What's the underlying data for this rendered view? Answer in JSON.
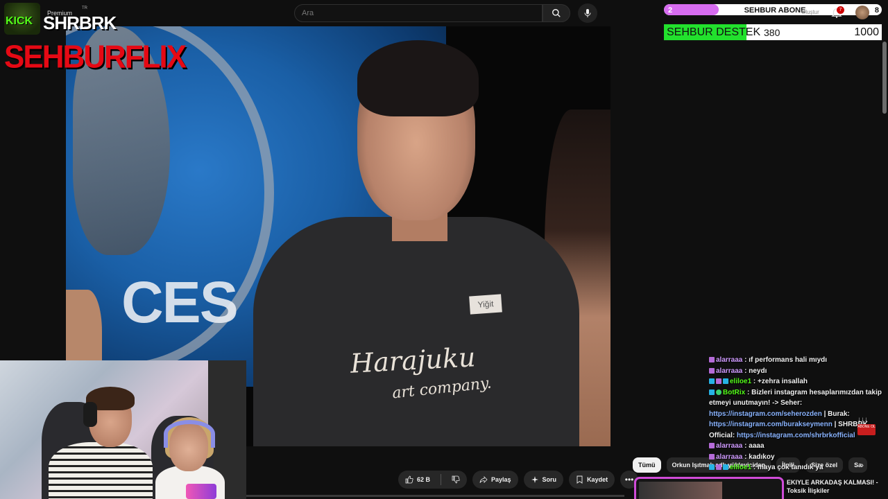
{
  "search": {
    "placeholder": "Ara"
  },
  "header": {
    "olustur_label": "Oluştur",
    "notification_count": "7"
  },
  "logo": {
    "kick": "KICK",
    "premium": "Premium",
    "tr": "TR",
    "channel": "SHRBRK",
    "brand": "SEHBURFLIX"
  },
  "overlay": {
    "sub_goal": {
      "current": "2",
      "title": "SEHBUR ABONE",
      "max": "8",
      "progress_fraction": 0.25,
      "color": "#d76cf0"
    },
    "donation": {
      "title": "SEHBUR DESTEK",
      "current": "380",
      "max": "1000",
      "progress_fraction": 0.38,
      "color": "#22e12d"
    }
  },
  "video": {
    "nametag": "Yiğit",
    "shirt_line1": "Harajuku",
    "shirt_line2": "art company.",
    "bg_text": "CES"
  },
  "actions": {
    "like_count": "62 B",
    "share": "Paylaş",
    "ask": "Soru",
    "save": "Kaydet",
    "icons": [
      "thumbs-up-icon",
      "thumbs-down-icon",
      "share-icon",
      "sparkle-icon",
      "bookmark-icon",
      "more-icon"
    ]
  },
  "chat": [
    {
      "user": "alarraaa",
      "text": ": ıf performans hali mıydı"
    },
    {
      "user": "alarraaa",
      "text": ": neydı"
    },
    {
      "user": "eliloe1",
      "text": ": +zehra insallah"
    },
    {
      "user": "BotRix",
      "text": ": Bizleri instagram hesaplarımızdan takip etmeyi unutmayın! -> Seher:",
      "link1": "https://instagram.com/seherozden",
      "mid1": " | Burak:",
      "link2": "https://instagram.com/burakseymenn",
      "mid2": " | SHRBRK Official:",
      "link3": "https://instagram.com/shrbrkofficial"
    },
    {
      "user": "alarraaa",
      "text": ": aaaa"
    },
    {
      "user": "alarraaa",
      "text": ": kadıkoy"
    },
    {
      "user": "eliloe1",
      "text": ": maya çok tanıdık ya"
    }
  ],
  "chips": [
    "Tümü",
    "Orkun Işıtmak adlı yükleyiciden",
    "İlgili",
    "Size özel",
    "Sa"
  ],
  "recommendation": {
    "title_line1": "EKIYLE ARKADAŞ KALMASI! -",
    "title_line2": "Toksik İlişkiler"
  },
  "sticker": {
    "text": "ABONE OL"
  },
  "arrows": "↓↓↓"
}
